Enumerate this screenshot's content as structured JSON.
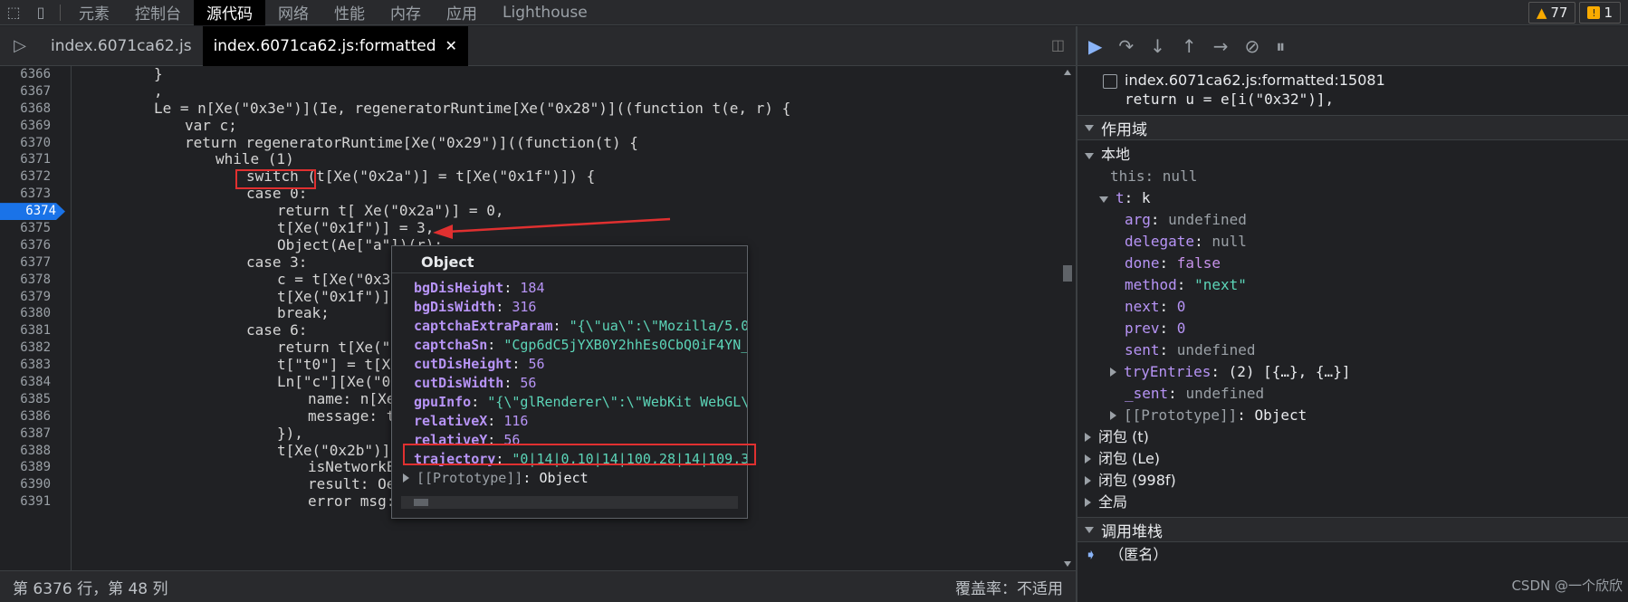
{
  "topbar": {
    "tabs": [
      "元素",
      "控制台",
      "源代码",
      "网络",
      "性能",
      "内存",
      "应用",
      "Lighthouse"
    ],
    "active_tab": 2,
    "warnings": "77",
    "errors": "1"
  },
  "filetabs": {
    "tab1": "index.6071ca62.js",
    "tab2": "index.6071ca62.js:formatted",
    "close": "✕"
  },
  "code": {
    "lines": [
      {
        "n": "6366",
        "ind": 5,
        "t": "}"
      },
      {
        "n": "6367",
        "ind": 5,
        "t": ","
      },
      {
        "n": "6368",
        "ind": 5,
        "t": "Le = n[Xe(\"0x3e\")](Ie, regeneratorRuntime[Xe(\"0x28\")]((function t(e, r) {"
      },
      {
        "n": "6369",
        "ind": 6,
        "t": "var c;"
      },
      {
        "n": "6370",
        "ind": 6,
        "t": "return regeneratorRuntime[Xe(\"0x29\")]((function(t) {"
      },
      {
        "n": "6371",
        "ind": 7,
        "t": "while (1)"
      },
      {
        "n": "6372",
        "ind": 8,
        "t": "switch (t[Xe(\"0x2a\")] = t[Xe(\"0x1f\")]) {"
      },
      {
        "n": "6373",
        "ind": 8,
        "t": "case 0:"
      },
      {
        "n": "6374",
        "ind": 9,
        "t": "return t[ Xe(\"0x2a\")] = 0,"
      },
      {
        "n": "6375",
        "ind": 9,
        "t": "t[Xe(\"0x1f\")] = 3,"
      },
      {
        "n": "6376",
        "ind": 9,
        "t": "Object(Ae[\"a\"])(r);"
      },
      {
        "n": "6377",
        "ind": 8,
        "t": "case 3:"
      },
      {
        "n": "6378",
        "ind": 9,
        "t": "c = t[Xe(\"0x3f\""
      },
      {
        "n": "6379",
        "ind": 9,
        "t": "t[Xe(\"0x1f\")] ="
      },
      {
        "n": "6380",
        "ind": 9,
        "t": "break;"
      },
      {
        "n": "6381",
        "ind": 8,
        "t": "case 6:"
      },
      {
        "n": "6382",
        "ind": 9,
        "t": "return t[Xe(\"0x"
      },
      {
        "n": "6383",
        "ind": 9,
        "t": "t[\"t0\"] = t[Xe("
      },
      {
        "n": "6384",
        "ind": 9,
        "t": "Ln[\"c\"][Xe(\"0x4"
      },
      {
        "n": "6385",
        "ind": 10,
        "t": "name: n[Xe("
      },
      {
        "n": "6386",
        "ind": 10,
        "t": "message: t["
      },
      {
        "n": "6387",
        "ind": 9,
        "t": "}),"
      },
      {
        "n": "6388",
        "ind": 9,
        "t": "t[Xe(\"0x2b\")](n"
      },
      {
        "n": "6389",
        "ind": 10,
        "t": "isNetworkEr"
      },
      {
        "n": "6390",
        "ind": 10,
        "t": "result: Oe,"
      },
      {
        "n": "6391",
        "ind": 10,
        "t": "error msg:"
      }
    ],
    "current_line": "6374"
  },
  "popover": {
    "title": "Object",
    "rows": [
      {
        "k": "bgDisHeight",
        "v": "184",
        "type": "num"
      },
      {
        "k": "bgDisWidth",
        "v": "316",
        "type": "num"
      },
      {
        "k": "captchaExtraParam",
        "v": "\"{\\\"ua\\\":\\\"Mozilla/5.0",
        "type": "str"
      },
      {
        "k": "captchaSn",
        "v": "\"Cgp6dC5jYXB0Y2hhEs0CbQ0iF4YN_V",
        "type": "str"
      },
      {
        "k": "cutDisHeight",
        "v": "56",
        "type": "num"
      },
      {
        "k": "cutDisWidth",
        "v": "56",
        "type": "num"
      },
      {
        "k": "gpuInfo",
        "v": "\"{\\\"glRenderer\\\":\\\"WebKit WebGL\\\"",
        "type": "str"
      },
      {
        "k": "relativeX",
        "v": "116",
        "type": "num"
      },
      {
        "k": "relativeY",
        "v": "56",
        "type": "num"
      },
      {
        "k": "trajectory",
        "v": "\"0|14|0,10|14|100,28|14|109,39",
        "type": "str"
      }
    ],
    "proto": "[[Prototype]]",
    "proto_val": "Object"
  },
  "status": {
    "position": "第 6376 行，第 48 列",
    "coverage": "覆盖率：不适用"
  },
  "right": {
    "bp_file": "index.6071ca62.js:formatted:15081",
    "bp_code": "return u = e[i(\"0x32\")],",
    "scope_title": "作用域",
    "local_title": "本地",
    "this_k": "this",
    "this_v": "null",
    "t_k": "t",
    "t_v": "k",
    "fields": [
      {
        "k": "arg",
        "v": "undefined",
        "type": "null"
      },
      {
        "k": "delegate",
        "v": "null",
        "type": "null"
      },
      {
        "k": "done",
        "v": "false",
        "type": "bool"
      },
      {
        "k": "method",
        "v": "\"next\"",
        "type": "str"
      },
      {
        "k": "next",
        "v": "0",
        "type": "num"
      },
      {
        "k": "prev",
        "v": "0",
        "type": "num"
      },
      {
        "k": "sent",
        "v": "undefined",
        "type": "null"
      }
    ],
    "tryEntries_k": "tryEntries",
    "tryEntries_v": "(2) [{…}, {…}]",
    "_sent_k": "_sent",
    "_sent_v": "undefined",
    "proto_k": "[[Prototype]]",
    "proto_v": "Object",
    "closures": [
      "闭包 (t)",
      "闭包 (Le)",
      "闭包 (998f)",
      "全局"
    ],
    "callstack_title": "调用堆栈",
    "callstack_item": "（匿名）",
    "watermark": "CSDN @一个欣欣"
  }
}
